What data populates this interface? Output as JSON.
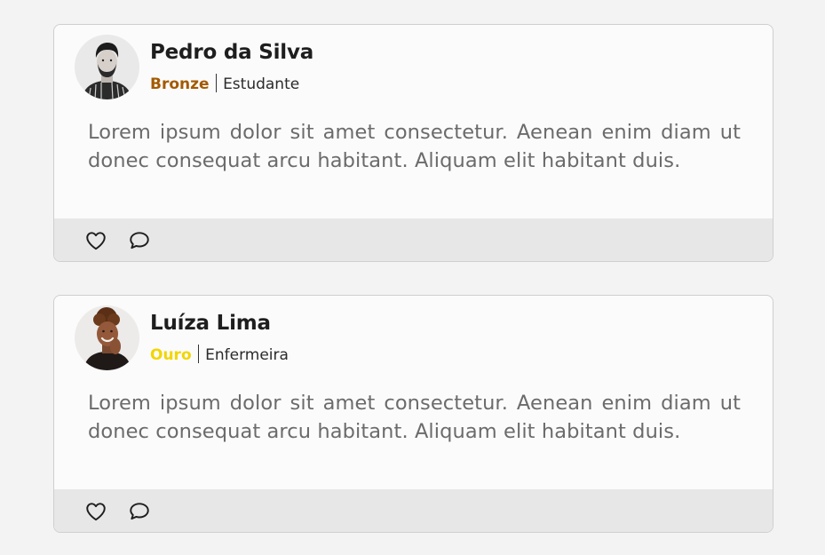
{
  "posts": [
    {
      "author": "Pedro da Silva",
      "tier": "Bronze",
      "tier_color": "#a35a00",
      "role": "Estudante",
      "text": "Lorem ipsum dolor sit amet consectetur. Aenean enim diam ut donec consequat arcu habitant. Aliquam elit habitant duis.",
      "avatar": "man-portrait",
      "actions": [
        {
          "icon": "heart-icon"
        },
        {
          "icon": "comment-icon"
        }
      ]
    },
    {
      "author": "Luíza Lima",
      "tier": "Ouro",
      "tier_color": "#f2d600",
      "role": "Enfermeira",
      "text": "Lorem ipsum dolor sit amet consectetur. Aenean enim diam ut donec consequat arcu habitant. Aliquam elit habitant duis.",
      "avatar": "woman-portrait",
      "actions": [
        {
          "icon": "heart-icon"
        },
        {
          "icon": "comment-icon"
        }
      ]
    }
  ]
}
